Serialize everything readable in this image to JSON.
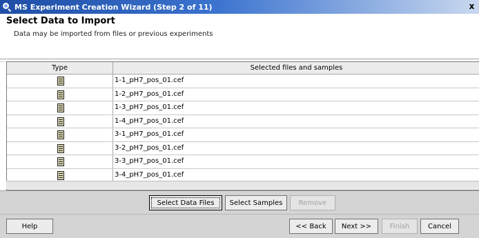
{
  "window": {
    "title": "MS Experiment Creation Wizard (Step 2 of 11)",
    "close_glyph": "x"
  },
  "header": {
    "title": "Select Data to Import",
    "subtitle": "Data may be imported from files or previous experiments"
  },
  "table": {
    "columns": [
      "Type",
      "Selected files and samples"
    ],
    "rows": [
      {
        "icon": "document-icon",
        "name": "1-1_pH7_pos_01.cef"
      },
      {
        "icon": "document-icon",
        "name": "1-2_pH7_pos_01.cef"
      },
      {
        "icon": "document-icon",
        "name": "1-3_pH7_pos_01.cef"
      },
      {
        "icon": "document-icon",
        "name": "1-4_pH7_pos_01.cef"
      },
      {
        "icon": "document-icon",
        "name": "3-1_pH7_pos_01.cef"
      },
      {
        "icon": "document-icon",
        "name": "3-2_pH7_pos_01.cef"
      },
      {
        "icon": "document-icon",
        "name": "3-3_pH7_pos_01.cef"
      },
      {
        "icon": "document-icon",
        "name": "3-4_pH7_pos_01.cef"
      }
    ]
  },
  "actions": {
    "select_data_files": "Select Data Files",
    "select_samples": "Select Samples",
    "remove": "Remove"
  },
  "footer": {
    "help": "Help",
    "back": "<< Back",
    "next": "Next >>",
    "finish": "Finish",
    "cancel": "Cancel"
  }
}
